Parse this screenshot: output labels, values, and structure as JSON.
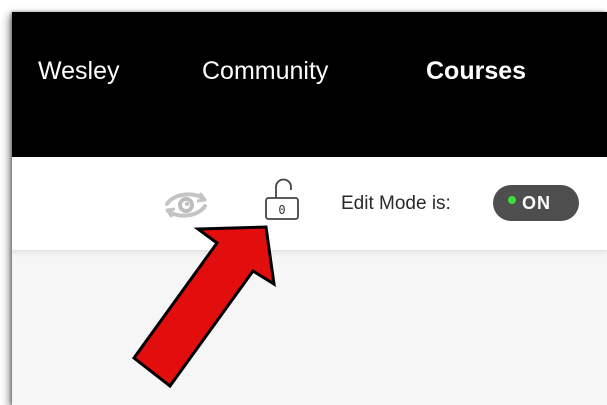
{
  "nav": {
    "items": [
      {
        "label": "Wesley"
      },
      {
        "label": "Community"
      },
      {
        "label": "Courses",
        "active": true
      }
    ]
  },
  "toolbar": {
    "student_preview_icon": "eye-refresh-icon",
    "lock_icon": "unlock-icon",
    "lock_count": "0",
    "edit_mode_label": "Edit Mode is:",
    "edit_mode_toggle": "ON",
    "edit_mode_on": true
  },
  "annotation": {
    "icon": "arrow-icon",
    "color": "#e20d0d"
  },
  "colors": {
    "nav_bg": "#000000",
    "toolbar_bg": "#ffffff",
    "content_bg": "#f6f6f6",
    "toggle_bg": "#4e4e4e",
    "toggle_indicator": "#3ddc3d"
  }
}
